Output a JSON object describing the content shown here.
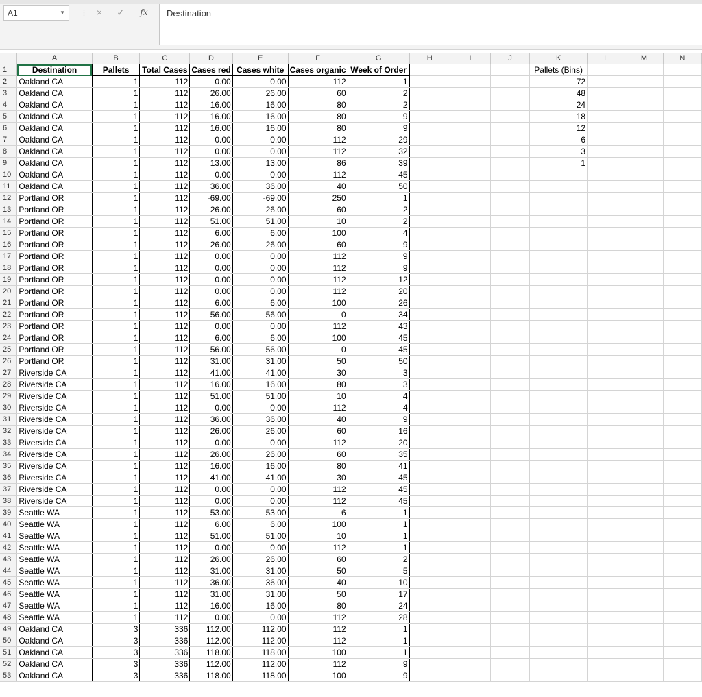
{
  "formula_bar": {
    "name_box": "A1",
    "cancel_icon": "×",
    "enter_icon": "✓",
    "fx_label": "fx",
    "formula": "Destination"
  },
  "columns": [
    "A",
    "B",
    "C",
    "D",
    "E",
    "F",
    "G",
    "H",
    "I",
    "J",
    "K",
    "L",
    "M",
    "N"
  ],
  "header": [
    "Destination",
    "Pallets",
    "Total Cases",
    "Cases red",
    "Cases white",
    "Cases organic",
    "Week of Order"
  ],
  "side_table": {
    "header": "Pallets (Bins)",
    "values": [
      "72",
      "48",
      "24",
      "18",
      "12",
      "6",
      "3",
      "1"
    ]
  },
  "rows": [
    [
      "Oakland CA",
      "1",
      "112",
      "0.00",
      "0.00",
      "112",
      "1"
    ],
    [
      "Oakland CA",
      "1",
      "112",
      "26.00",
      "26.00",
      "60",
      "2"
    ],
    [
      "Oakland CA",
      "1",
      "112",
      "16.00",
      "16.00",
      "80",
      "2"
    ],
    [
      "Oakland CA",
      "1",
      "112",
      "16.00",
      "16.00",
      "80",
      "9"
    ],
    [
      "Oakland CA",
      "1",
      "112",
      "16.00",
      "16.00",
      "80",
      "9"
    ],
    [
      "Oakland CA",
      "1",
      "112",
      "0.00",
      "0.00",
      "112",
      "29"
    ],
    [
      "Oakland CA",
      "1",
      "112",
      "0.00",
      "0.00",
      "112",
      "32"
    ],
    [
      "Oakland CA",
      "1",
      "112",
      "13.00",
      "13.00",
      "86",
      "39"
    ],
    [
      "Oakland CA",
      "1",
      "112",
      "0.00",
      "0.00",
      "112",
      "45"
    ],
    [
      "Oakland CA",
      "1",
      "112",
      "36.00",
      "36.00",
      "40",
      "50"
    ],
    [
      "Portland OR",
      "1",
      "112",
      "-69.00",
      "-69.00",
      "250",
      "1"
    ],
    [
      "Portland OR",
      "1",
      "112",
      "26.00",
      "26.00",
      "60",
      "2"
    ],
    [
      "Portland OR",
      "1",
      "112",
      "51.00",
      "51.00",
      "10",
      "2"
    ],
    [
      "Portland OR",
      "1",
      "112",
      "6.00",
      "6.00",
      "100",
      "4"
    ],
    [
      "Portland OR",
      "1",
      "112",
      "26.00",
      "26.00",
      "60",
      "9"
    ],
    [
      "Portland OR",
      "1",
      "112",
      "0.00",
      "0.00",
      "112",
      "9"
    ],
    [
      "Portland OR",
      "1",
      "112",
      "0.00",
      "0.00",
      "112",
      "9"
    ],
    [
      "Portland OR",
      "1",
      "112",
      "0.00",
      "0.00",
      "112",
      "12"
    ],
    [
      "Portland OR",
      "1",
      "112",
      "0.00",
      "0.00",
      "112",
      "20"
    ],
    [
      "Portland OR",
      "1",
      "112",
      "6.00",
      "6.00",
      "100",
      "26"
    ],
    [
      "Portland OR",
      "1",
      "112",
      "56.00",
      "56.00",
      "0",
      "34"
    ],
    [
      "Portland OR",
      "1",
      "112",
      "0.00",
      "0.00",
      "112",
      "43"
    ],
    [
      "Portland OR",
      "1",
      "112",
      "6.00",
      "6.00",
      "100",
      "45"
    ],
    [
      "Portland OR",
      "1",
      "112",
      "56.00",
      "56.00",
      "0",
      "45"
    ],
    [
      "Portland OR",
      "1",
      "112",
      "31.00",
      "31.00",
      "50",
      "50"
    ],
    [
      "Riverside CA",
      "1",
      "112",
      "41.00",
      "41.00",
      "30",
      "3"
    ],
    [
      "Riverside CA",
      "1",
      "112",
      "16.00",
      "16.00",
      "80",
      "3"
    ],
    [
      "Riverside CA",
      "1",
      "112",
      "51.00",
      "51.00",
      "10",
      "4"
    ],
    [
      "Riverside CA",
      "1",
      "112",
      "0.00",
      "0.00",
      "112",
      "4"
    ],
    [
      "Riverside CA",
      "1",
      "112",
      "36.00",
      "36.00",
      "40",
      "9"
    ],
    [
      "Riverside CA",
      "1",
      "112",
      "26.00",
      "26.00",
      "60",
      "16"
    ],
    [
      "Riverside CA",
      "1",
      "112",
      "0.00",
      "0.00",
      "112",
      "20"
    ],
    [
      "Riverside CA",
      "1",
      "112",
      "26.00",
      "26.00",
      "60",
      "35"
    ],
    [
      "Riverside CA",
      "1",
      "112",
      "16.00",
      "16.00",
      "80",
      "41"
    ],
    [
      "Riverside CA",
      "1",
      "112",
      "41.00",
      "41.00",
      "30",
      "45"
    ],
    [
      "Riverside CA",
      "1",
      "112",
      "0.00",
      "0.00",
      "112",
      "45"
    ],
    [
      "Riverside CA",
      "1",
      "112",
      "0.00",
      "0.00",
      "112",
      "45"
    ],
    [
      "Seattle WA",
      "1",
      "112",
      "53.00",
      "53.00",
      "6",
      "1"
    ],
    [
      "Seattle WA",
      "1",
      "112",
      "6.00",
      "6.00",
      "100",
      "1"
    ],
    [
      "Seattle WA",
      "1",
      "112",
      "51.00",
      "51.00",
      "10",
      "1"
    ],
    [
      "Seattle WA",
      "1",
      "112",
      "0.00",
      "0.00",
      "112",
      "1"
    ],
    [
      "Seattle WA",
      "1",
      "112",
      "26.00",
      "26.00",
      "60",
      "2"
    ],
    [
      "Seattle WA",
      "1",
      "112",
      "31.00",
      "31.00",
      "50",
      "5"
    ],
    [
      "Seattle WA",
      "1",
      "112",
      "36.00",
      "36.00",
      "40",
      "10"
    ],
    [
      "Seattle WA",
      "1",
      "112",
      "31.00",
      "31.00",
      "50",
      "17"
    ],
    [
      "Seattle WA",
      "1",
      "112",
      "16.00",
      "16.00",
      "80",
      "24"
    ],
    [
      "Seattle WA",
      "1",
      "112",
      "0.00",
      "0.00",
      "112",
      "28"
    ],
    [
      "Oakland CA",
      "3",
      "336",
      "112.00",
      "112.00",
      "112",
      "1"
    ],
    [
      "Oakland CA",
      "3",
      "336",
      "112.00",
      "112.00",
      "112",
      "1"
    ],
    [
      "Oakland CA",
      "3",
      "336",
      "118.00",
      "118.00",
      "100",
      "1"
    ],
    [
      "Oakland CA",
      "3",
      "336",
      "112.00",
      "112.00",
      "112",
      "9"
    ],
    [
      "Oakland CA",
      "3",
      "336",
      "118.00",
      "118.00",
      "100",
      "9"
    ]
  ]
}
